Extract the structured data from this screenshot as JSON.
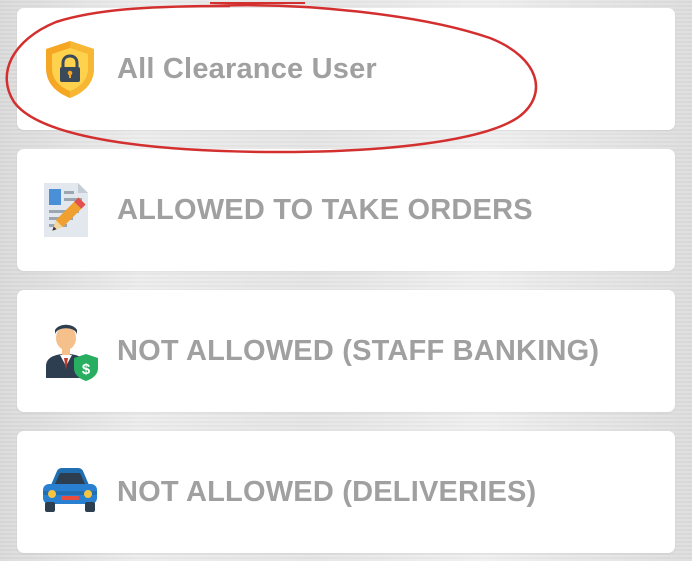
{
  "menu": {
    "items": [
      {
        "label": "All Clearance User",
        "icon": "shield-lock-icon"
      },
      {
        "label": "ALLOWED TO TAKE ORDERS",
        "icon": "document-pencil-icon"
      },
      {
        "label": "NOT ALLOWED (STAFF BANKING)",
        "icon": "staff-banking-icon"
      },
      {
        "label": "NOT ALLOWED (DELIVERIES)",
        "icon": "car-icon"
      }
    ]
  },
  "colors": {
    "label_text": "#a0a0a0",
    "card_background": "#ffffff",
    "annotation": "#d32f2f"
  }
}
